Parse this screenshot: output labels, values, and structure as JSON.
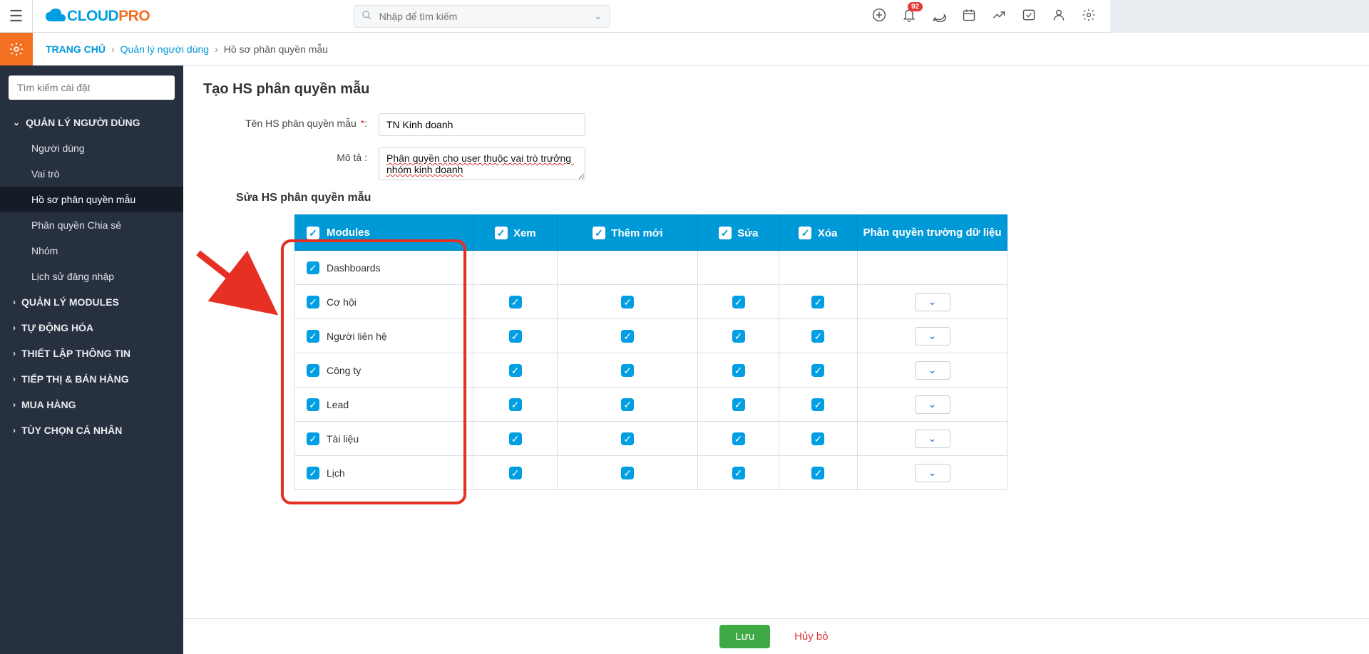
{
  "header": {
    "search_placeholder": "Nhập để tìm kiếm",
    "notif_count": "92"
  },
  "breadcrumb": {
    "home": "TRANG CHỦ",
    "mid": "Quản lý người dùng",
    "cur": "Hồ sơ phân quyền mẫu"
  },
  "sidebar": {
    "search_placeholder": "Tìm kiếm cài đặt",
    "groups": {
      "g0": "QUẢN LÝ NGƯỜI DÙNG",
      "g1": "QUẢN LÝ MODULES",
      "g2": "TỰ ĐỘNG HÓA",
      "g3": "THIẾT LẬP THÔNG TIN",
      "g4": "TIẾP THỊ & BÁN HÀNG",
      "g5": "MUA HÀNG",
      "g6": "TÙY CHỌN CÁ NHÂN"
    },
    "items": {
      "i0": "Người dùng",
      "i1": "Vai trò",
      "i2": "Hồ sơ phân quyền mẫu",
      "i3": "Phân quyền Chia sẻ",
      "i4": "Nhóm",
      "i5": "Lịch sử đăng nhập"
    }
  },
  "page": {
    "title": "Tạo HS phân quyền mẫu",
    "name_label": "Tên HS phân quyền mẫu",
    "name_value": "TN Kinh doanh",
    "desc_label": "Mô tả :",
    "desc_value": "Phân quyền cho user thuộc vai trò trưởng nhóm kinh doanh",
    "section_title": "Sửa HS phân quyền mẫu"
  },
  "table": {
    "headers": {
      "modules": "Modules",
      "view": "Xem",
      "add": "Thêm mới",
      "edit": "Sửa",
      "del": "Xóa",
      "field": "Phân quyền trường dữ liệu"
    },
    "modules": {
      "m0": "Dashboards",
      "m1": "Cơ hội",
      "m2": "Người liên hệ",
      "m3": "Công ty",
      "m4": "Lead",
      "m5": "Tài liệu",
      "m6": "Lịch"
    }
  },
  "actions": {
    "save": "Lưu",
    "cancel": "Hủy bỏ"
  }
}
